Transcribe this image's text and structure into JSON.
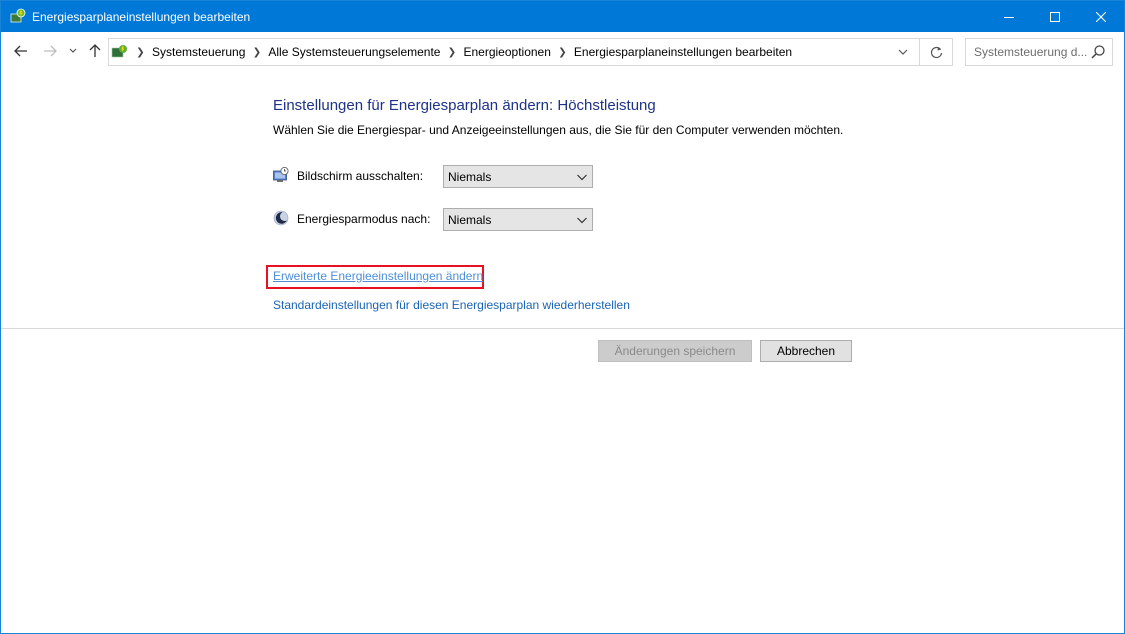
{
  "window": {
    "title": "Energiesparplaneinstellungen bearbeiten",
    "titlebar_color": "#0078d7",
    "controls": [
      "minimize-icon",
      "maximize-icon",
      "close-icon"
    ]
  },
  "nav": {
    "breadcrumbs": [
      "Systemsteuerung",
      "Alle Systemsteuerungselemente",
      "Energieoptionen",
      "Energiesparplaneinstellungen bearbeiten"
    ],
    "search_placeholder": "Systemsteuerung d..."
  },
  "main": {
    "heading": "Einstellungen für Energiesparplan ändern: Höchstleistung",
    "subtitle": "Wählen Sie die Energiespar- und Anzeigeeinstellungen aus, die Sie für den Computer verwenden möchten.",
    "settings": [
      {
        "label": "Bildschirm ausschalten:",
        "value": "Niemals",
        "icon": "monitor-clock-icon"
      },
      {
        "label": "Energiesparmodus nach:",
        "value": "Niemals",
        "icon": "moon-icon"
      }
    ],
    "links": {
      "advanced": "Erweiterte Energieeinstellungen ändern",
      "restore": "Standardeinstellungen für diesen Energiesparplan wiederherstellen"
    },
    "highlight_color": "#e81123"
  },
  "buttons": {
    "save": "Änderungen speichern",
    "cancel": "Abbrechen"
  },
  "colors": {
    "heading": "#1e3287",
    "link": "#1a64b5"
  }
}
